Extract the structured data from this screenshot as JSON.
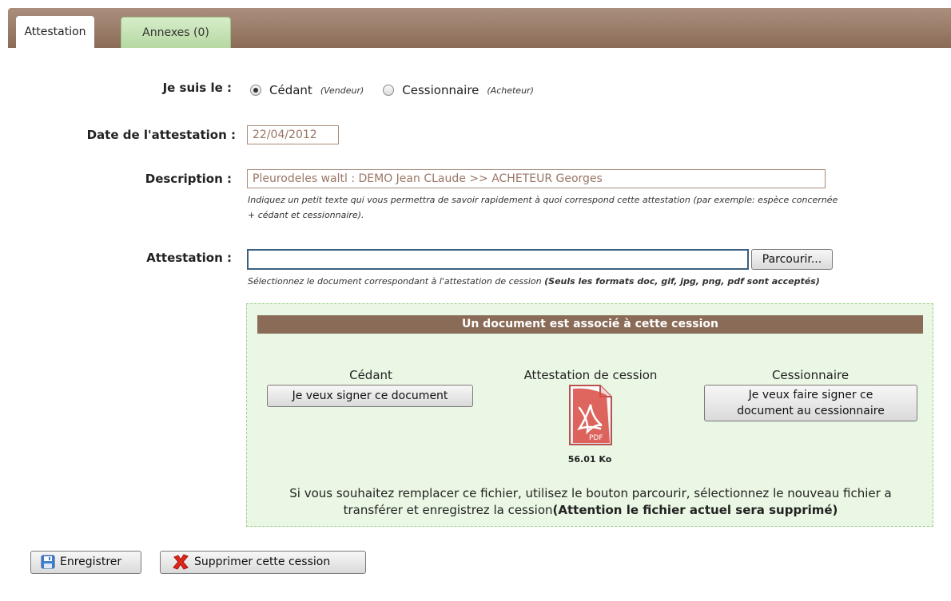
{
  "tabs": [
    {
      "label": "Attestation",
      "active": true
    },
    {
      "label": "Annexes (0)",
      "active": false
    }
  ],
  "form": {
    "role_label": "Je suis le :",
    "role_options": [
      {
        "label": "Cédant",
        "hint": "(Vendeur)",
        "checked": true
      },
      {
        "label": "Cessionnaire",
        "hint": "(Acheteur)",
        "checked": false
      }
    ],
    "date_label": "Date de l'attestation :",
    "date_value": "22/04/2012",
    "description_label": "Description :",
    "description_value": "Pleurodeles waltl : DEMO Jean CLaude >> ACHETEUR Georges",
    "description_hint_1": "Indiquez un petit texte qui vous permettra de savoir rapidement à quoi correspond cette attestation (par exemple: espèce concernée",
    "description_hint_2": "+ cédant et cessionnaire).",
    "attestation_label": "Attestation :",
    "browse_button": "Parcourir...",
    "attestation_hint": "Sélectionnez le document correspondant à l'attestation de cession ",
    "attestation_hint_bold": "(Seuls les formats doc, gif, jpg, png, pdf sont acceptés)"
  },
  "document_panel": {
    "header": "Un document est associé à cette cession",
    "cedant_title": "Cédant",
    "cedant_button": "Je veux signer ce document",
    "attestation_title": "Attestation de cession",
    "pdf_label": "PDF",
    "file_size": "56.01 Ko",
    "cessionnaire_title": "Cessionnaire",
    "cessionnaire_button_1": "Je veux faire signer ce",
    "cessionnaire_button_2": "document au cessionnaire",
    "notice_1": "Si vous souhaitez remplacer ce fichier, utilisez le bouton parcourir, sélectionnez le nouveau fichier a",
    "notice_2": "transférer et enregistrez la cession",
    "notice_bold": "(Attention le fichier actuel sera supprimé)"
  },
  "actions": {
    "save_label": "Enregistrer",
    "delete_label": "Supprimer cette cession"
  },
  "colors": {
    "tab_bar": "#8a6b58",
    "panel_bg": "#eaf7e4",
    "input_text": "#9a7664"
  }
}
